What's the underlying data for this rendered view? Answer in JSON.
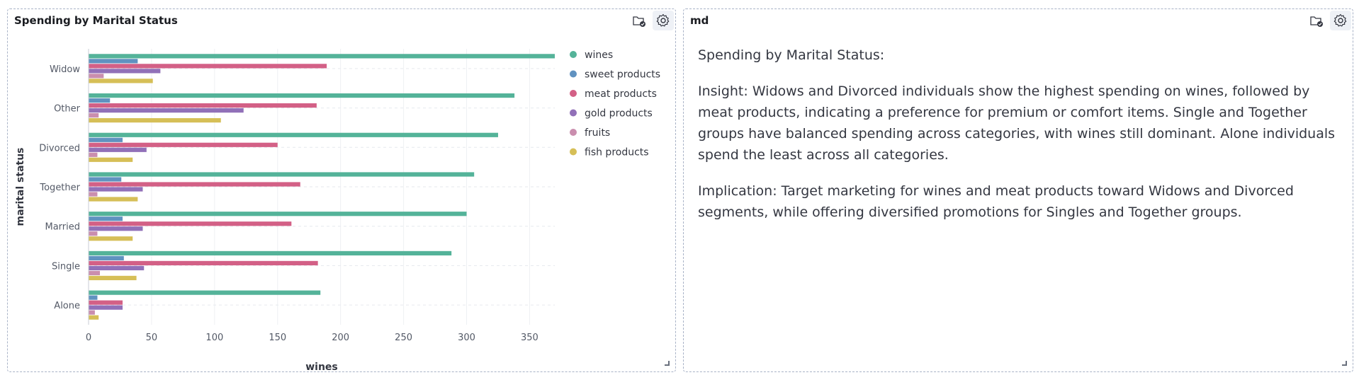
{
  "panels": {
    "chart_panel": {
      "title": "Spending by Marital Status"
    },
    "md_panel": {
      "title": "md",
      "paragraphs": [
        "Spending by Marital Status:",
        "Insight: Widows and Divorced individuals show the highest spending on wines, followed by meat products, indicating a preference for premium or comfort items. Single and Together groups have balanced spending across categories, with wines still dominant. Alone individuals spend the least across all categories.",
        "Implication: Target marketing for wines and meat products toward Widows and Divorced segments, while offering diversified promotions for Singles and Together groups."
      ]
    }
  },
  "icons": {
    "folder": "folder-check-icon",
    "gear": "gear-icon",
    "resize": "resize-handle-icon"
  },
  "chart_data": {
    "type": "bar",
    "orientation": "horizontal",
    "title": "",
    "xlabel": "wines",
    "ylabel": "marital status",
    "categories": [
      "Widow",
      "Other",
      "Divorced",
      "Together",
      "Married",
      "Single",
      "Alone"
    ],
    "xlim": [
      0,
      370
    ],
    "xticks": [
      0,
      50,
      100,
      150,
      200,
      250,
      300,
      350
    ],
    "grid": true,
    "legend_position": "right",
    "series": [
      {
        "name": "wines",
        "color": "#54b399",
        "values": [
          370,
          338,
          325,
          306,
          300,
          288,
          184
        ]
      },
      {
        "name": "sweet products",
        "color": "#6092c0",
        "values": [
          39,
          17,
          27,
          26,
          27,
          28,
          7
        ]
      },
      {
        "name": "meat products",
        "color": "#d36086",
        "values": [
          189,
          181,
          150,
          168,
          161,
          182,
          27
        ]
      },
      {
        "name": "gold products",
        "color": "#9170b8",
        "values": [
          57,
          123,
          46,
          43,
          43,
          44,
          27
        ]
      },
      {
        "name": "fruits",
        "color": "#ca8eae",
        "values": [
          12,
          8,
          7,
          7,
          7,
          9,
          5
        ]
      },
      {
        "name": "fish products",
        "color": "#d6bf57",
        "values": [
          51,
          105,
          35,
          39,
          35,
          38,
          8
        ]
      }
    ]
  }
}
